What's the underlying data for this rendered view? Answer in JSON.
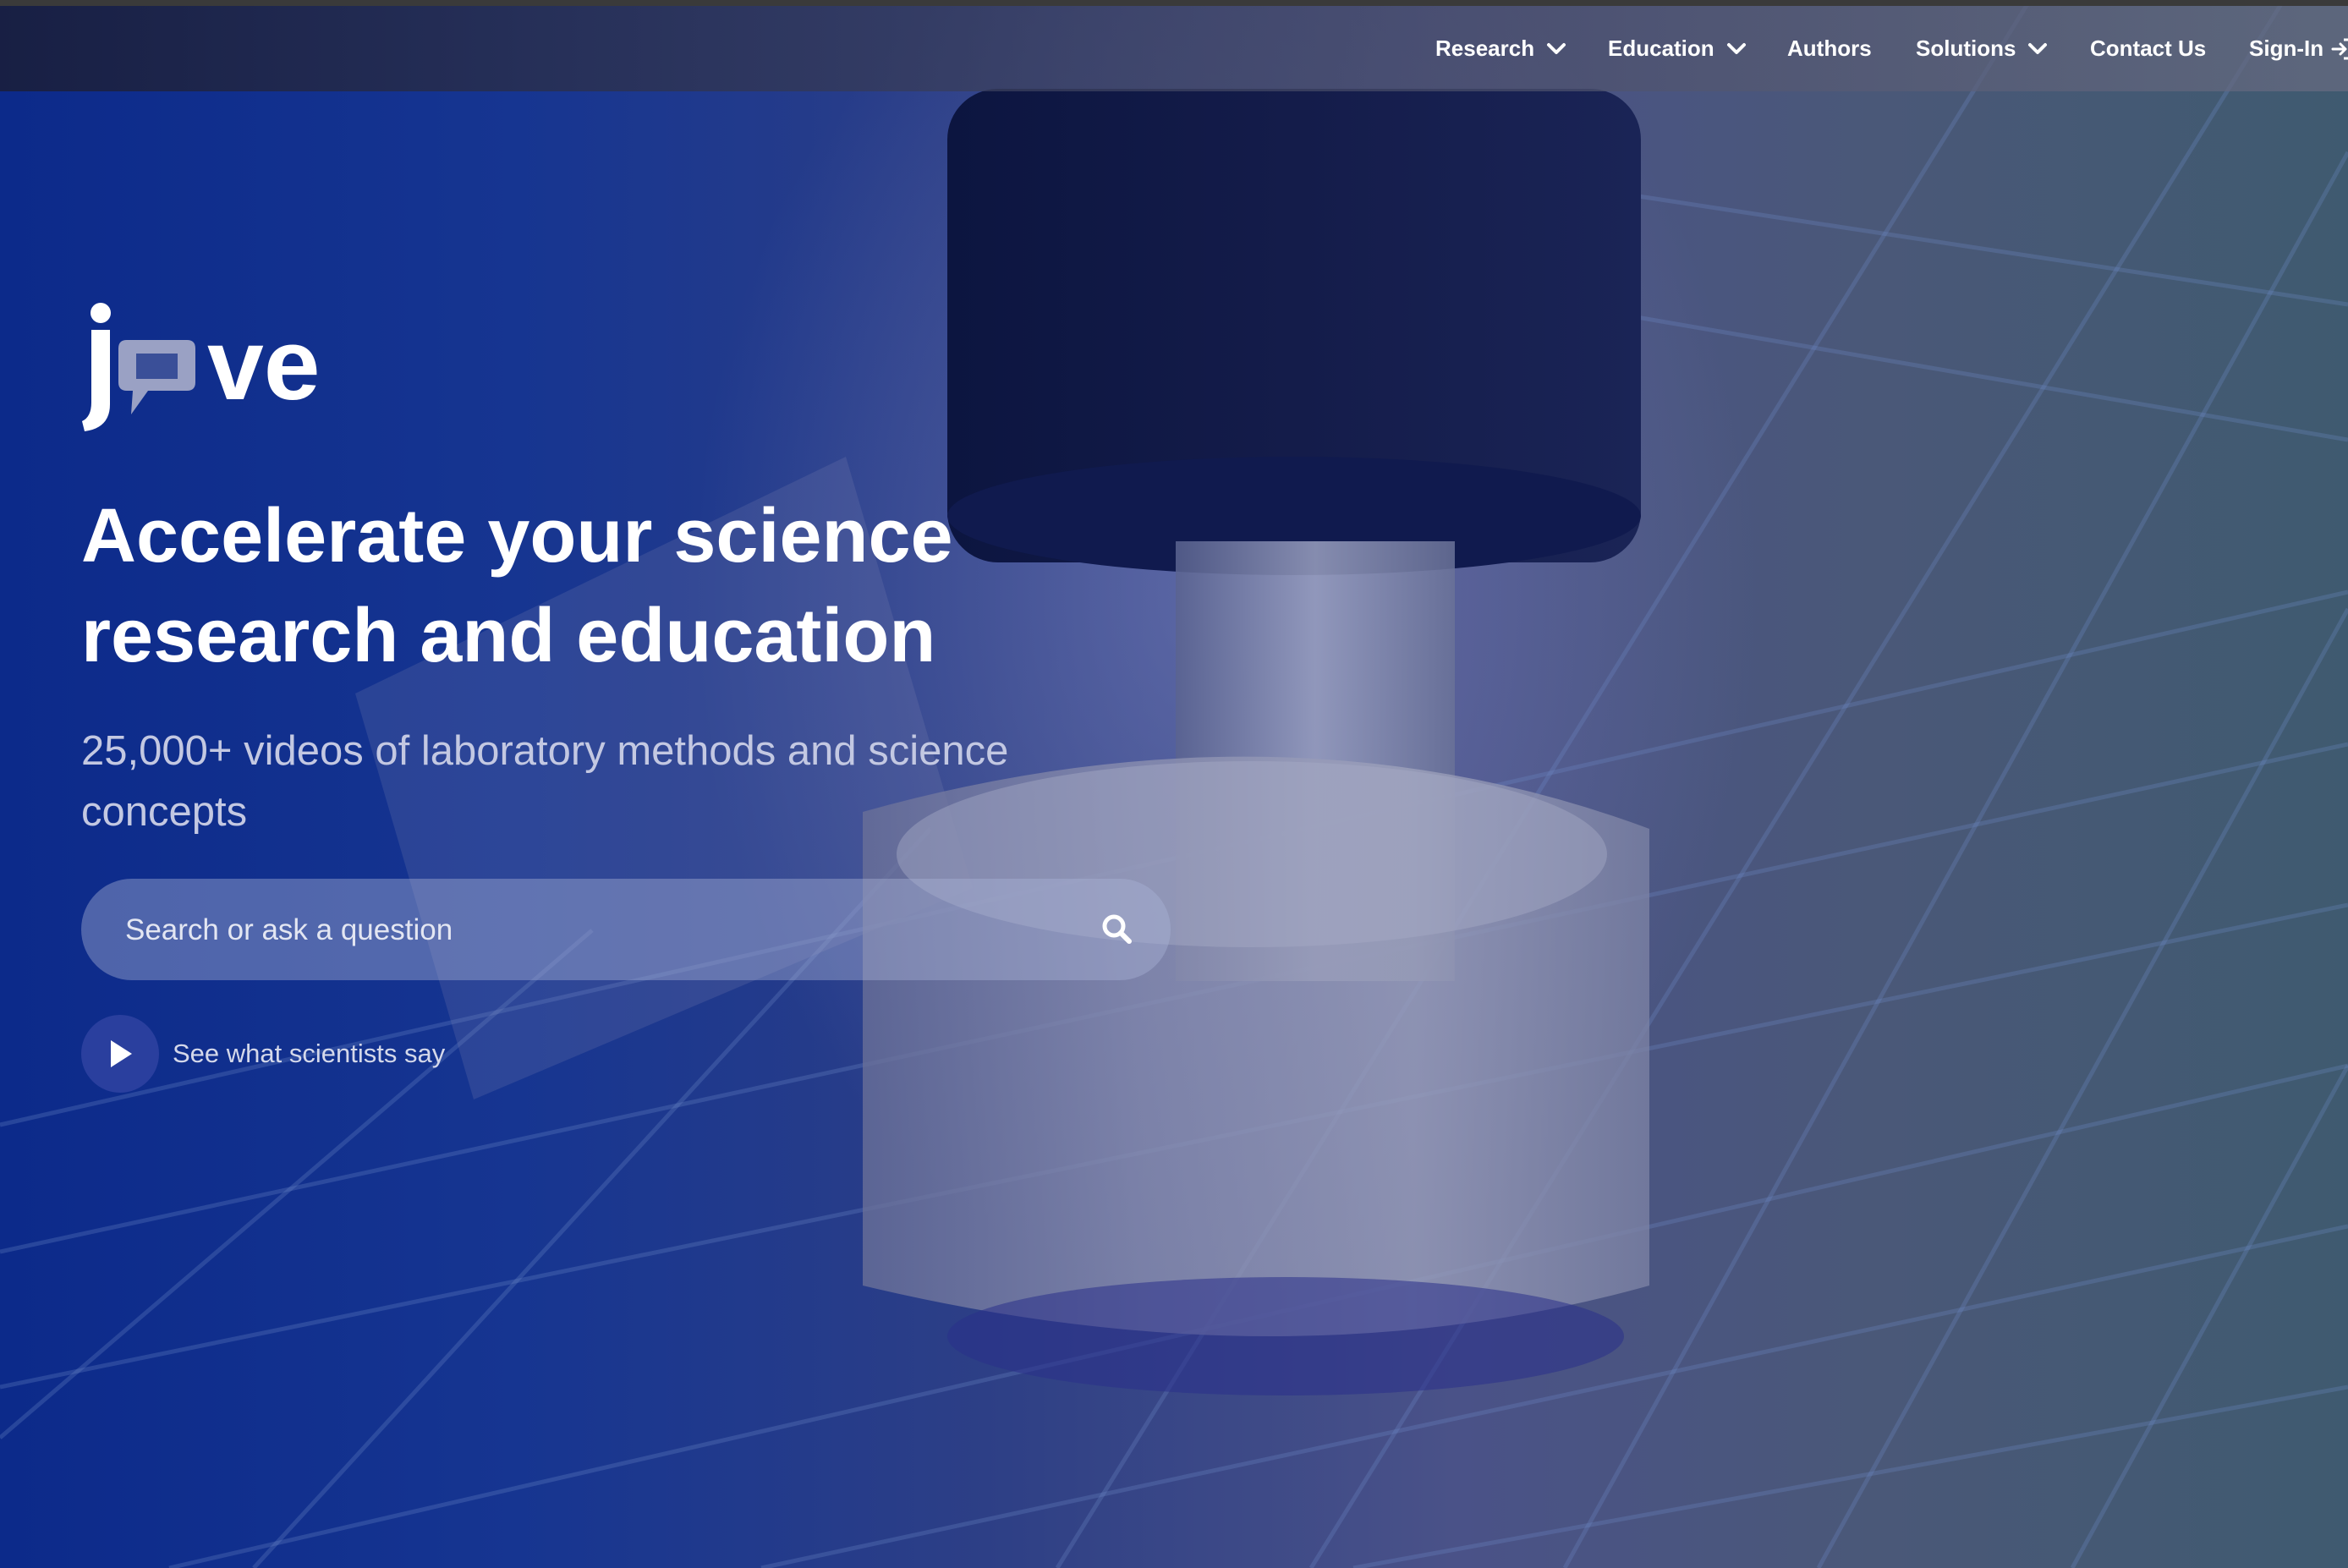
{
  "brand": {
    "logo_text": "jove",
    "logo_icon": "speech-bubble-icon"
  },
  "nav": {
    "items": [
      {
        "label": "Research",
        "has_dropdown": true
      },
      {
        "label": "Education",
        "has_dropdown": true
      },
      {
        "label": "Authors",
        "has_dropdown": false
      },
      {
        "label": "Solutions",
        "has_dropdown": true
      },
      {
        "label": "Contact Us",
        "has_dropdown": false
      }
    ],
    "signin": {
      "label": "Sign-In",
      "icon": "sign-in-icon"
    }
  },
  "hero": {
    "headline": "Accelerate your science research and education",
    "subtitle": "25,000+ videos of laboratory methods and science concepts",
    "search": {
      "placeholder": "Search or ask a question",
      "value": "",
      "icon": "search-icon"
    },
    "video_cta": {
      "label": "See what scientists say",
      "icon": "play-icon"
    }
  },
  "colors": {
    "hero_left": "#0c2a8a",
    "hero_right": "#3f5a70",
    "text_primary": "#ffffff",
    "text_secondary": "#c3c8e2",
    "play_button": "#2a3f9e"
  }
}
